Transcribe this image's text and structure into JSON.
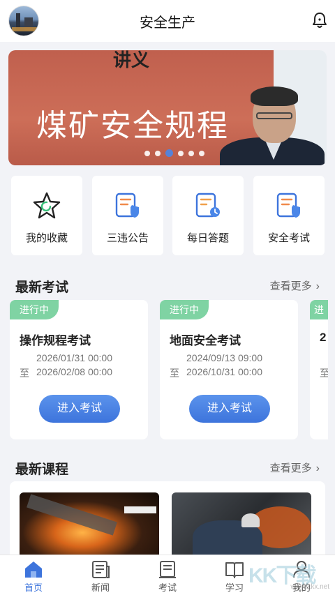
{
  "header": {
    "title": "安全生产"
  },
  "banner": {
    "top_text": "讲义",
    "headline": "煤矿安全规程",
    "dots_count": 6,
    "active_dot": 2
  },
  "quick_actions": [
    {
      "label": "我的收藏",
      "icon": "star-icon"
    },
    {
      "label": "三违公告",
      "icon": "notice-shield-icon"
    },
    {
      "label": "每日答题",
      "icon": "clock-document-icon"
    },
    {
      "label": "安全考试",
      "icon": "exam-shield-icon"
    }
  ],
  "exams_section": {
    "title": "最新考试",
    "more": "查看更多"
  },
  "exams": [
    {
      "status": "进行中",
      "name": "操作规程考试",
      "start": "2026/01/31 00:00",
      "to": "至",
      "end": "2026/02/08 00:00",
      "button": "进入考试"
    },
    {
      "status": "进行中",
      "name": "地面安全考试",
      "start": "2024/09/13 09:00",
      "to": "至",
      "end": "2026/10/31 00:00",
      "button": "进入考试"
    },
    {
      "status": "进",
      "name": "2",
      "to": "至"
    }
  ],
  "courses_section": {
    "title": "最新课程",
    "more": "查看更多"
  },
  "courses": [
    {
      "caption": ""
    },
    {
      "caption": ""
    }
  ],
  "tabbar": [
    {
      "label": "首页",
      "icon": "home-icon",
      "active": true
    },
    {
      "label": "新闻",
      "icon": "news-icon",
      "active": false
    },
    {
      "label": "考试",
      "icon": "exam-icon",
      "active": false
    },
    {
      "label": "学习",
      "icon": "book-icon",
      "active": false
    },
    {
      "label": "我的",
      "icon": "user-icon",
      "active": false
    }
  ],
  "watermark": {
    "text": "KK下载",
    "sub": "www.kkx.net"
  },
  "colors": {
    "accent": "#3d74dc",
    "badge": "#7fd3a3",
    "banner_red": "#cd6e58"
  }
}
